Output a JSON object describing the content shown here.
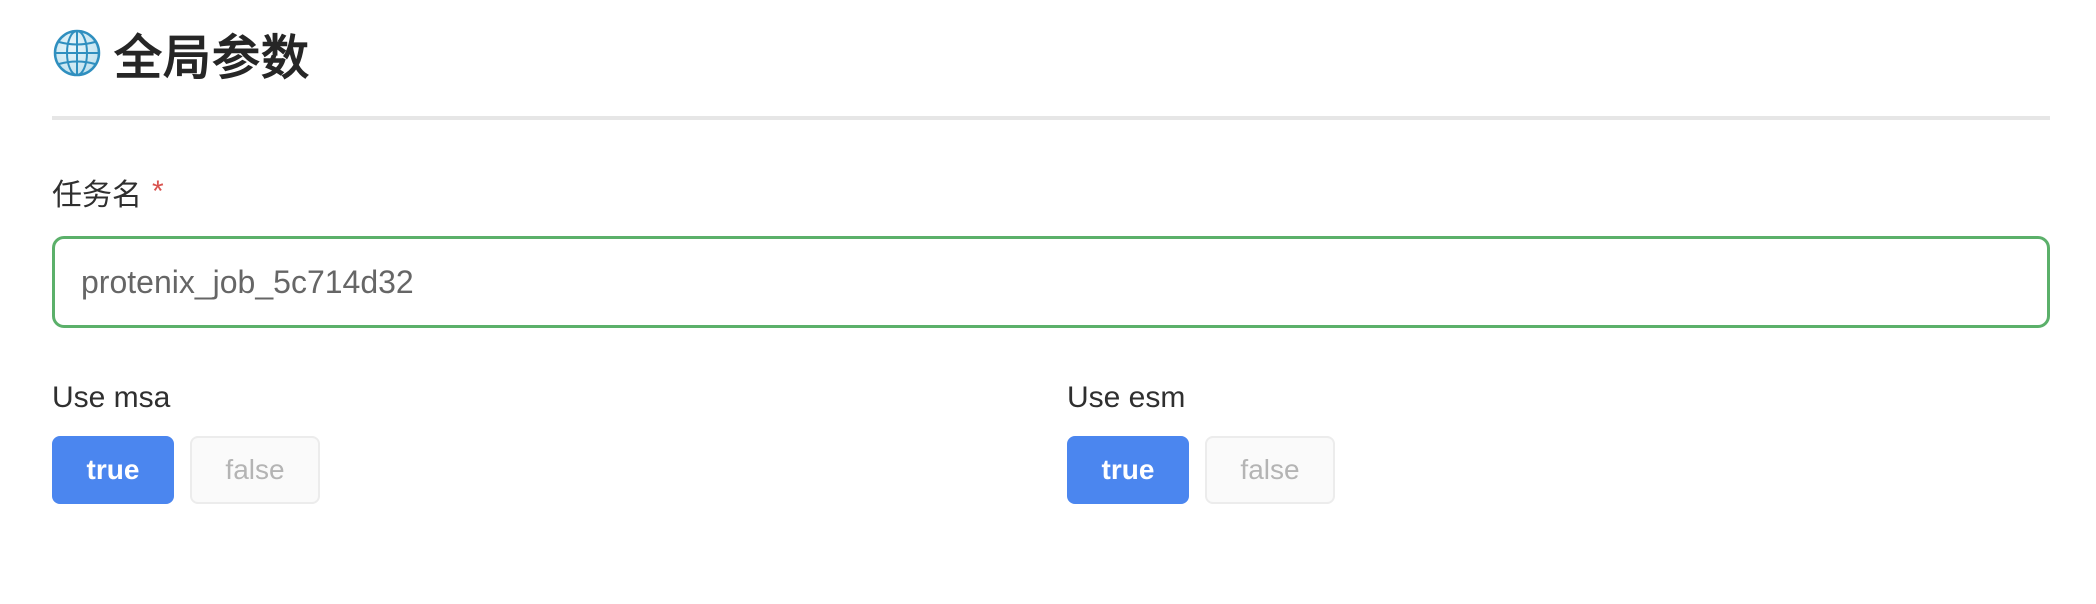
{
  "section": {
    "title": "全局参数",
    "icon": "globe-icon"
  },
  "task_name": {
    "label": "任务名",
    "required_marker": "*",
    "value": "protenix_job_5c714d32"
  },
  "use_msa": {
    "label": "Use msa",
    "options": [
      "true",
      "false"
    ],
    "selected": "true"
  },
  "use_esm": {
    "label": "Use esm",
    "options": [
      "true",
      "false"
    ],
    "selected": "true"
  },
  "colors": {
    "accent": "#4b86ef",
    "input_border_valid": "#5bb06a",
    "required": "#d9534f"
  }
}
